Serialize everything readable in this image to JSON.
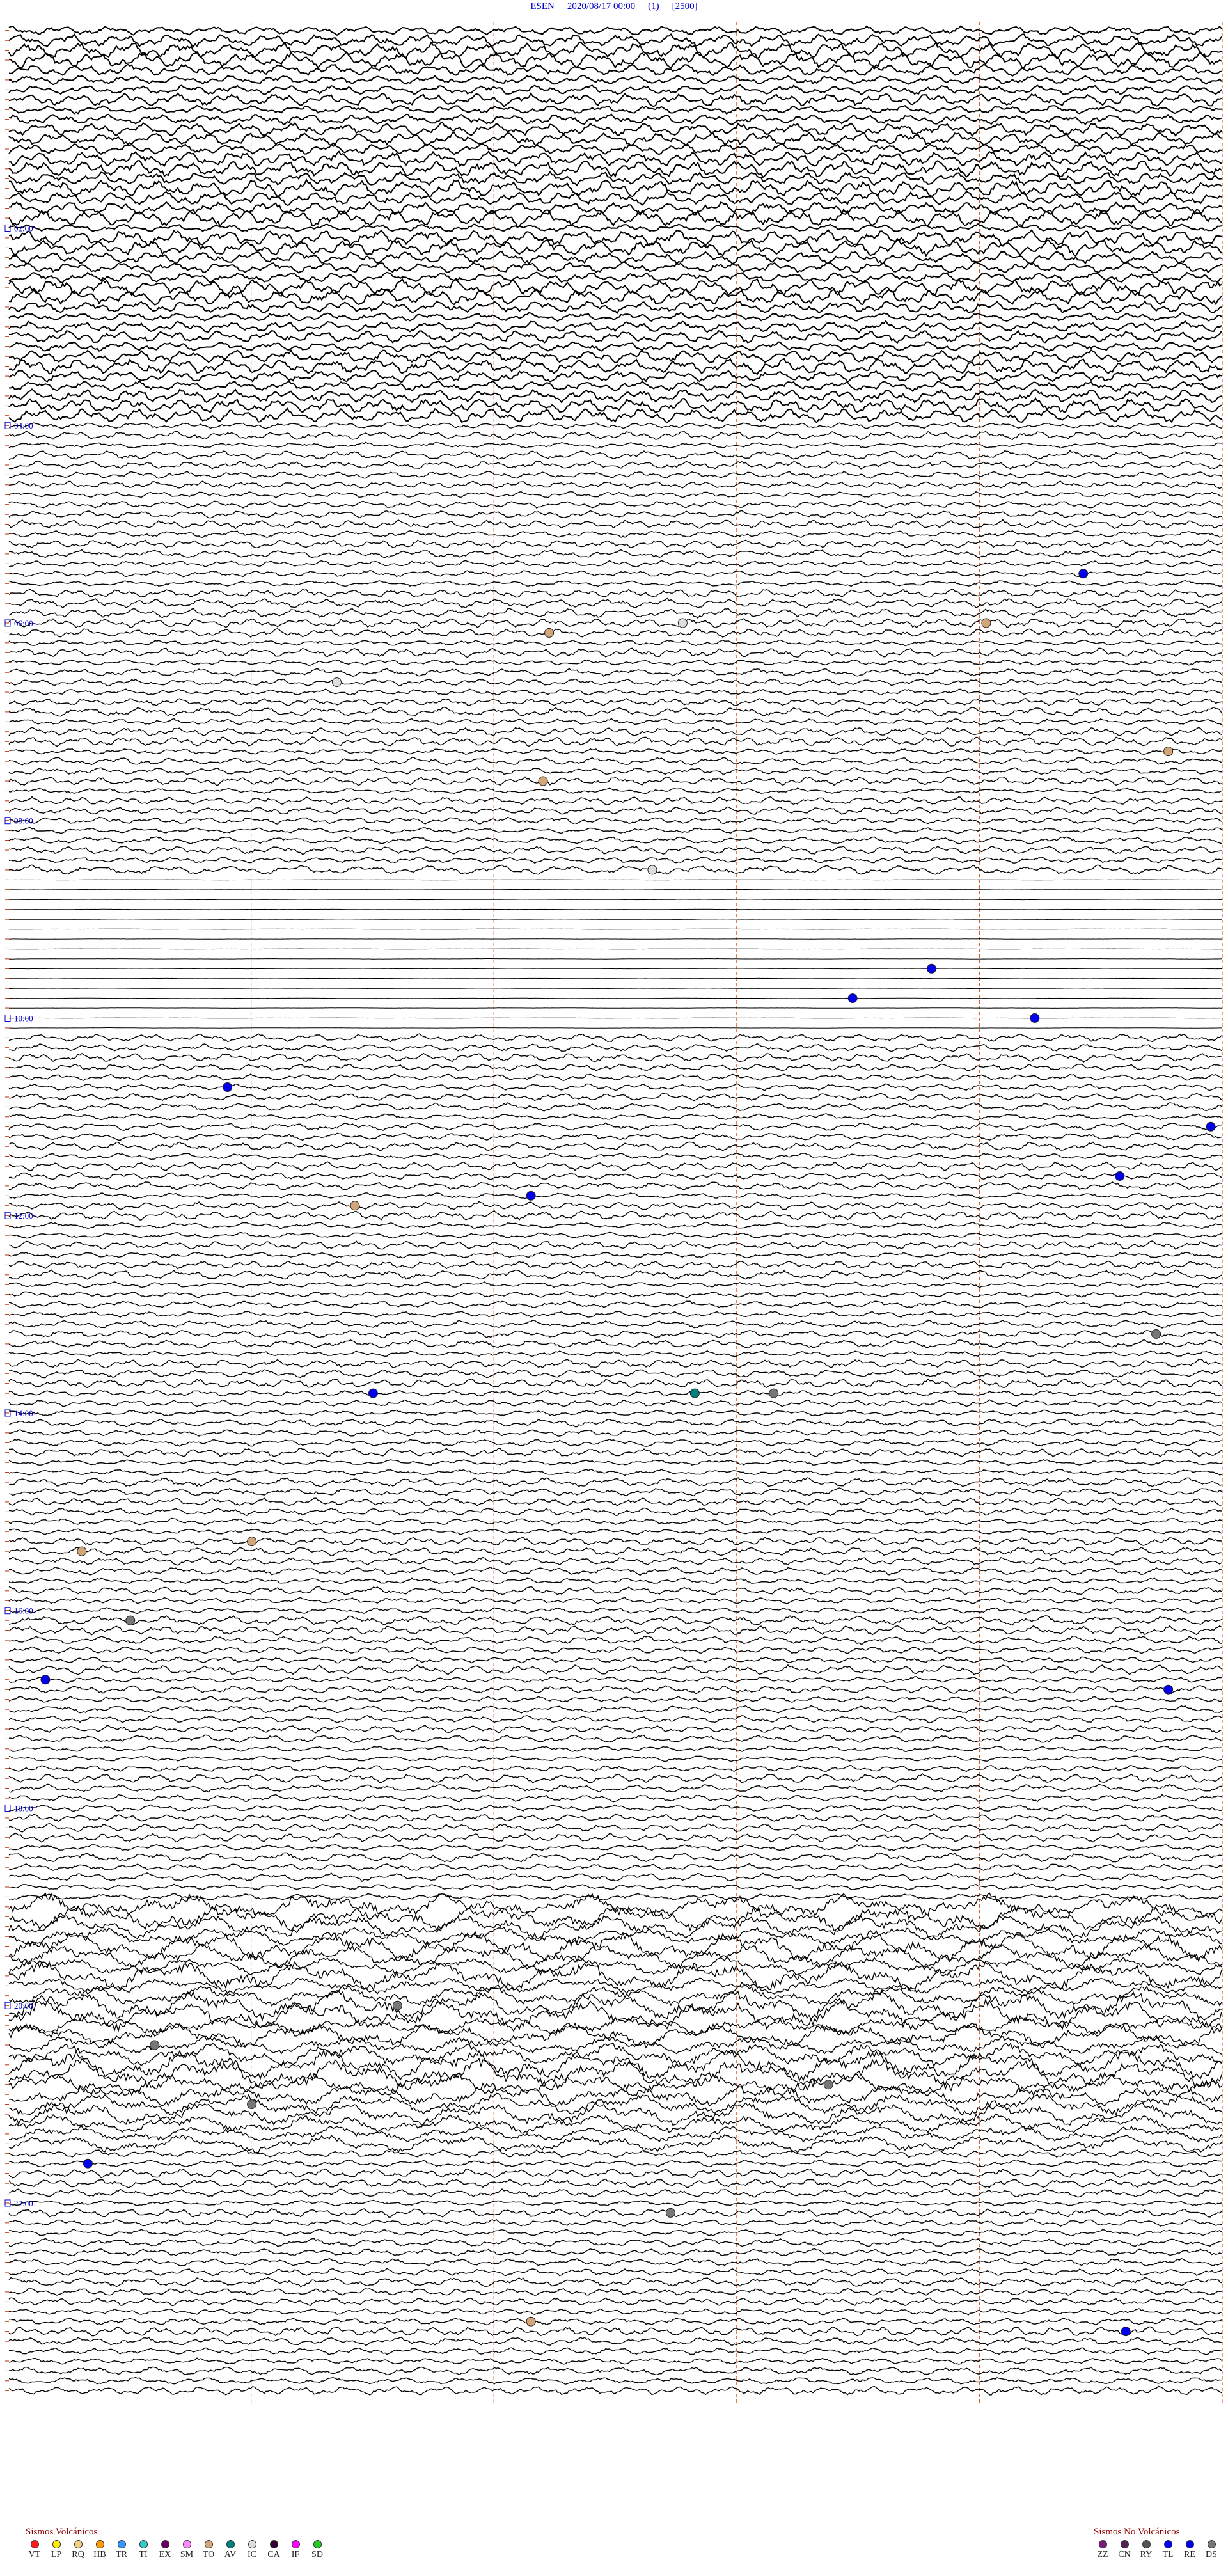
{
  "header": {
    "station": "ESEN",
    "datetime": "2020/08/17 00:00",
    "channel": "(1)",
    "gain": "[2500]"
  },
  "chart_data": {
    "type": "line",
    "description_kind": "helicorder",
    "rows_total": 121,
    "hour_labels": [
      "02:00",
      "04:00",
      "06:00",
      "08:00",
      "10:00",
      "12:00",
      "14:00",
      "16:00",
      "18:00",
      "20:00",
      "22:00"
    ],
    "minute_columns": 5,
    "colors": {
      "trace": "#000000",
      "hour_label": "#0000cc",
      "minute_grid": "#e06030",
      "title": "#0000cc",
      "row_tick": "#cc2200"
    },
    "flat_rows": [
      86,
      102
    ],
    "events": [
      {
        "row": 55,
        "x": 0.885,
        "type": "RE"
      },
      {
        "row": 60,
        "x": 0.555,
        "type": "IC"
      },
      {
        "row": 60,
        "x": 0.805,
        "type": "TO"
      },
      {
        "row": 61,
        "x": 0.445,
        "type": "TO"
      },
      {
        "row": 66,
        "x": 0.27,
        "type": "IC"
      },
      {
        "row": 73,
        "x": 0.955,
        "type": "TO"
      },
      {
        "row": 76,
        "x": 0.44,
        "type": "TO"
      },
      {
        "row": 85,
        "x": 0.53,
        "type": "IC"
      },
      {
        "row": 95,
        "x": 0.76,
        "type": "RE"
      },
      {
        "row": 98,
        "x": 0.695,
        "type": "RE"
      },
      {
        "row": 100,
        "x": 0.845,
        "type": "RE"
      },
      {
        "row": 107,
        "x": 0.18,
        "type": "RE"
      },
      {
        "row": 111,
        "x": 0.99,
        "type": "RE"
      },
      {
        "row": 116,
        "x": 0.915,
        "type": "RE"
      },
      {
        "row": 118,
        "x": 0.43,
        "type": "RE"
      },
      {
        "row": 119,
        "x": 0.285,
        "type": "TO"
      },
      {
        "row": 132,
        "x": 0.945,
        "type": "DS"
      },
      {
        "row": 138,
        "x": 0.3,
        "type": "RE"
      },
      {
        "row": 138,
        "x": 0.565,
        "type": "AV"
      },
      {
        "row": 138,
        "x": 0.63,
        "type": "DS"
      },
      {
        "row": 153,
        "x": 0.2,
        "type": "TO"
      },
      {
        "row": 154,
        "x": 0.06,
        "type": "TO"
      },
      {
        "row": 161,
        "x": 0.1,
        "type": "DS"
      },
      {
        "row": 167,
        "x": 0.03,
        "type": "RE"
      },
      {
        "row": 168,
        "x": 0.955,
        "type": "RE"
      },
      {
        "row": 200,
        "x": 0.32,
        "type": "DS"
      },
      {
        "row": 204,
        "x": 0.12,
        "type": "DS"
      },
      {
        "row": 208,
        "x": 0.675,
        "type": "DS"
      },
      {
        "row": 210,
        "x": 0.2,
        "type": "DS"
      },
      {
        "row": 216,
        "x": 0.065,
        "type": "RE"
      },
      {
        "row": 221,
        "x": 0.545,
        "type": "DS"
      },
      {
        "row": 232,
        "x": 0.43,
        "type": "TO"
      },
      {
        "row": 233,
        "x": 0.92,
        "type": "RE"
      }
    ]
  },
  "legend_volcanic": {
    "title": "Sismos Volcánicos",
    "items": [
      {
        "label": "VT",
        "color": "#ff1a1a"
      },
      {
        "label": "LP",
        "color": "#ffee00"
      },
      {
        "label": "RQ",
        "color": "#f0d080"
      },
      {
        "label": "HB",
        "color": "#ff9900"
      },
      {
        "label": "TR",
        "color": "#3399ff"
      },
      {
        "label": "TI",
        "color": "#33cccc"
      },
      {
        "label": "EX",
        "color": "#660066"
      },
      {
        "label": "SM",
        "color": "#ff88ff"
      },
      {
        "label": "TO",
        "color": "#d2a679"
      },
      {
        "label": "AV",
        "color": "#008080"
      },
      {
        "label": "IC",
        "color": "#dddddd"
      },
      {
        "label": "CA",
        "color": "#330033"
      },
      {
        "label": "IF",
        "color": "#ff00ff"
      },
      {
        "label": "SD",
        "color": "#22cc22"
      }
    ]
  },
  "legend_nonvolcanic": {
    "title": "Sismos No Volcánicos",
    "items": [
      {
        "label": "ZZ",
        "color": "#7a1a7a"
      },
      {
        "label": "CN",
        "color": "#552255"
      },
      {
        "label": "RY",
        "color": "#555555"
      },
      {
        "label": "TL",
        "color": "#0000ff"
      },
      {
        "label": "RE",
        "color": "#0000ee"
      },
      {
        "label": "DS",
        "color": "#777777"
      }
    ]
  }
}
